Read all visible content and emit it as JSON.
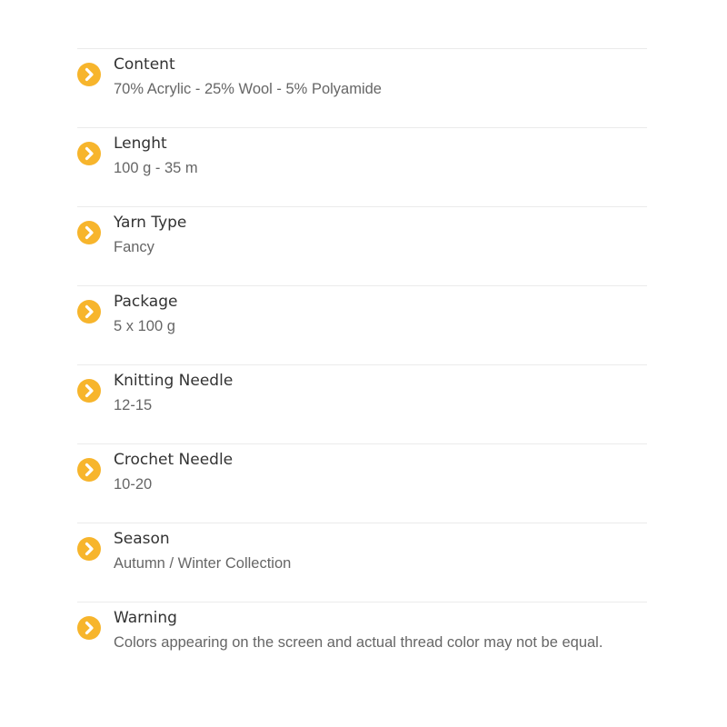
{
  "colors": {
    "accent": "#f7b52c",
    "label": "#333333",
    "value": "#666666",
    "divider": "#ebebeb"
  },
  "bullet_icon": "chevron-right-circle-icon",
  "specs": [
    {
      "label": "Content",
      "value": "70% Acrylic - 25% Wool - 5% Polyamide"
    },
    {
      "label": "Lenght",
      "value": "100 g - 35 m"
    },
    {
      "label": "Yarn Type",
      "value": "Fancy"
    },
    {
      "label": "Package",
      "value": "5 x 100 g"
    },
    {
      "label": "Knitting Needle",
      "value": "12-15"
    },
    {
      "label": "Crochet Needle",
      "value": "10-20"
    },
    {
      "label": "Season",
      "value": "Autumn / Winter Collection"
    },
    {
      "label": "Warning",
      "value": "Colors appearing on the screen and actual thread color may not be equal."
    }
  ]
}
